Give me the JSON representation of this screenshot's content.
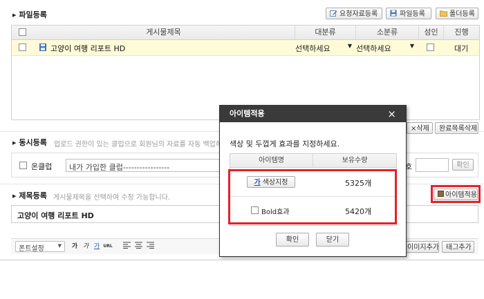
{
  "file_section": {
    "title": "파일등록",
    "buttons": {
      "request": "요청자료등록",
      "file": "파일등록",
      "folder": "폴더등록"
    },
    "columns": {
      "title": "게시물제목",
      "category": "대분류",
      "subcategory": "소분류",
      "adult": "성인",
      "status": "진행"
    },
    "rows": [
      {
        "title": "고양이 여행 리포트 HD",
        "category": "선택하세요",
        "subcategory": "선택하세요",
        "status": "대기"
      }
    ],
    "actions": {
      "delete": "×삭제",
      "delete_completed": "완료목록삭제"
    }
  },
  "sync_section": {
    "title": "동시등록",
    "desc": "업로드 권한이 있는 클럽으로 회원님의 자료를 자동 백업하",
    "onclub_label": "온클럽",
    "club_select": "내가 가입한 클럽-----------------",
    "right_label": "호",
    "confirm": "확인"
  },
  "title_section": {
    "title": "제목등록",
    "desc": "게시물제목을 선택하여 수정 가능합니다.",
    "item_apply": "아이템적용",
    "value": "고양이 여행 리포트 HD"
  },
  "editor": {
    "font": "폰트설정",
    "bold": "가",
    "italic": "가",
    "underline": "가",
    "url": "URL",
    "image_add": "이미지추가",
    "tag_add": "태그추가"
  },
  "modal": {
    "title": "아이템적용",
    "close": "×",
    "instruction": "색상 및 두껍게 효과를 지정하세요.",
    "columns": {
      "name": "아이템명",
      "qty": "보유수량"
    },
    "items": [
      {
        "name": "색상지정",
        "qty": "5325개"
      },
      {
        "name": "Bold효과",
        "qty": "5420개"
      }
    ],
    "confirm": "확인",
    "close_btn": "닫기"
  },
  "colors": {
    "highlight": "#e5202a",
    "modal_header": "#3a3a3a",
    "row_selected": "#fffbd9"
  }
}
